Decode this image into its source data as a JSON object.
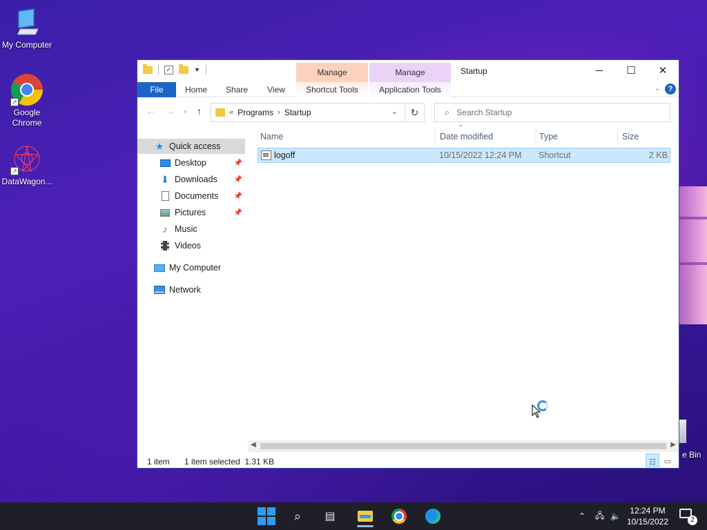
{
  "desktop": {
    "icons": [
      {
        "label": "My Computer"
      },
      {
        "label": "Google\nChrome"
      },
      {
        "label": "DataWagon..."
      }
    ],
    "recycle_bin_label": "e Bin"
  },
  "window": {
    "title": "Startup",
    "context_tabs": {
      "shortcut_manage": "Manage",
      "shortcut_tools": "Shortcut Tools",
      "app_manage": "Manage",
      "app_tools": "Application Tools"
    },
    "ribbon_tabs": [
      "File",
      "Home",
      "Share",
      "View"
    ],
    "address": {
      "overflow": "«",
      "crumbs": [
        "Programs",
        "Startup"
      ]
    },
    "search_placeholder": "Search Startup",
    "nav_pane": {
      "quick_access": "Quick access",
      "pinned": [
        "Desktop",
        "Downloads",
        "Documents",
        "Pictures"
      ],
      "unpinned": [
        "Music",
        "Videos"
      ],
      "my_computer": "My Computer",
      "network": "Network"
    },
    "columns": [
      "Name",
      "Date modified",
      "Type",
      "Size"
    ],
    "files": [
      {
        "name": "logoff",
        "date": "10/15/2022 12:24 PM",
        "type": "Shortcut",
        "size": "2 KB",
        "selected": true
      }
    ],
    "status": {
      "count": "1 item",
      "selection": "1 item selected  1.31 KB"
    }
  },
  "taskbar": {
    "clock_time": "12:24 PM",
    "clock_date": "10/15/2022",
    "notification_count": "2"
  }
}
